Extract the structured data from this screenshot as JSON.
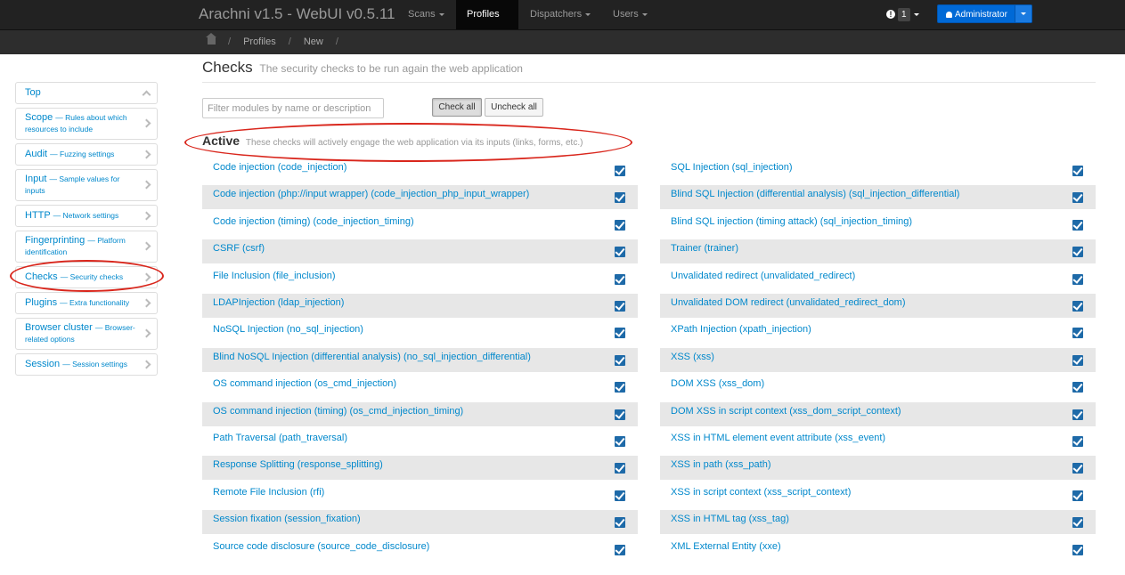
{
  "app": {
    "title": "Arachni v1.5 - WebUI v0.5.11"
  },
  "nav": {
    "scans": "Scans",
    "profiles": "Profiles",
    "dispatchers": "Dispatchers",
    "users": "Users",
    "notification_count": "1",
    "user": "Administrator"
  },
  "breadcrumb": {
    "items": [
      "Profiles",
      "New"
    ]
  },
  "sidebar": {
    "items": [
      {
        "label": "Top",
        "desc": ""
      },
      {
        "label": "Scope",
        "desc": "— Rules about which resources to include"
      },
      {
        "label": "Audit",
        "desc": "— Fuzzing settings"
      },
      {
        "label": "Input",
        "desc": "— Sample values for inputs"
      },
      {
        "label": "HTTP",
        "desc": "— Network settings"
      },
      {
        "label": "Fingerprinting",
        "desc": "— Platform identification"
      },
      {
        "label": "Checks",
        "desc": "— Security checks"
      },
      {
        "label": "Plugins",
        "desc": "— Extra functionality"
      },
      {
        "label": "Browser cluster",
        "desc": "— Browser-related options"
      },
      {
        "label": "Session",
        "desc": "— Session settings"
      }
    ]
  },
  "main": {
    "title": "Checks",
    "subtitle": "The security checks to be run again the web application",
    "filter_placeholder": "Filter modules by name or description",
    "check_all": "Check all",
    "uncheck_all": "Uncheck all",
    "section_title": "Active",
    "section_subtitle": "These checks will actively engage the web application via its inputs (links, forms, etc.)",
    "left_checks": [
      {
        "label": "Code injection (code_injection)",
        "checked": true
      },
      {
        "label": "Code injection (php://input wrapper) (code_injection_php_input_wrapper)",
        "checked": true
      },
      {
        "label": "Code injection (timing) (code_injection_timing)",
        "checked": true
      },
      {
        "label": "CSRF (csrf)",
        "checked": true
      },
      {
        "label": "File Inclusion (file_inclusion)",
        "checked": true
      },
      {
        "label": "LDAPInjection (ldap_injection)",
        "checked": true
      },
      {
        "label": "NoSQL Injection (no_sql_injection)",
        "checked": true
      },
      {
        "label": "Blind NoSQL Injection (differential analysis) (no_sql_injection_differential)",
        "checked": true
      },
      {
        "label": "OS command injection (os_cmd_injection)",
        "checked": true
      },
      {
        "label": "OS command injection (timing) (os_cmd_injection_timing)",
        "checked": true
      },
      {
        "label": "Path Traversal (path_traversal)",
        "checked": true
      },
      {
        "label": "Response Splitting (response_splitting)",
        "checked": true
      },
      {
        "label": "Remote File Inclusion (rfi)",
        "checked": true
      },
      {
        "label": "Session fixation (session_fixation)",
        "checked": true
      },
      {
        "label": "Source code disclosure (source_code_disclosure)",
        "checked": true
      }
    ],
    "right_checks": [
      {
        "label": "SQL Injection (sql_injection)",
        "checked": true
      },
      {
        "label": "Blind SQL Injection (differential analysis) (sql_injection_differential)",
        "checked": true
      },
      {
        "label": "Blind SQL injection (timing attack) (sql_injection_timing)",
        "checked": true
      },
      {
        "label": "Trainer (trainer)",
        "checked": true
      },
      {
        "label": "Unvalidated redirect (unvalidated_redirect)",
        "checked": true
      },
      {
        "label": "Unvalidated DOM redirect (unvalidated_redirect_dom)",
        "checked": true
      },
      {
        "label": "XPath Injection (xpath_injection)",
        "checked": true
      },
      {
        "label": "XSS (xss)",
        "checked": true
      },
      {
        "label": "DOM XSS (xss_dom)",
        "checked": true
      },
      {
        "label": "DOM XSS in script context (xss_dom_script_context)",
        "checked": true
      },
      {
        "label": "XSS in HTML element event attribute (xss_event)",
        "checked": true
      },
      {
        "label": "XSS in path (xss_path)",
        "checked": true
      },
      {
        "label": "XSS in script context (xss_script_context)",
        "checked": true
      },
      {
        "label": "XSS in HTML tag (xss_tag)",
        "checked": true
      },
      {
        "label": "XML External Entity (xxe)",
        "checked": true
      }
    ]
  },
  "colors": {
    "link": "#0088cc",
    "navbar": "#222222",
    "annotation": "#d9261c",
    "checkbox": "#1e6aa8"
  }
}
